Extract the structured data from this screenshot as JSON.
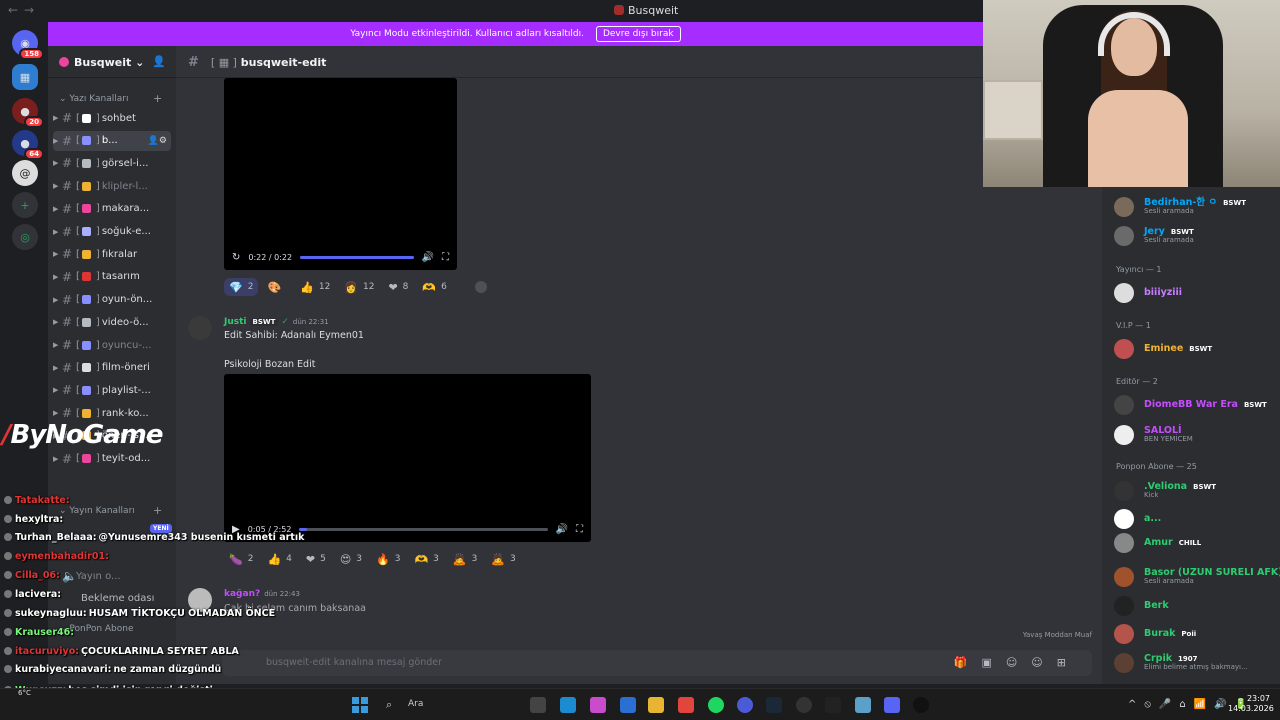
{
  "window": {
    "title": "Busqweit"
  },
  "banner": {
    "text": "Yayıncı Modu etkinleştirildi. Kullanıcı adları kısaltıldı.",
    "button": "Devre dışı bırak"
  },
  "rail": {
    "badges": [
      "158",
      "20",
      "64"
    ]
  },
  "guild": {
    "name": "Busqweit"
  },
  "sidebar": {
    "categories": [
      "Yazı Kanalları",
      "Yayın Kanalları",
      "PonPon Abone"
    ],
    "channels": [
      {
        "name": "sohbet",
        "color": "#dbdee1"
      },
      {
        "name": "b...",
        "color": "#ffffff"
      },
      {
        "name": "görsel-i...",
        "color": "#dbdee1"
      },
      {
        "name": "klipler-l...",
        "color": "#80848e"
      },
      {
        "name": "makara...",
        "color": "#dbdee1"
      },
      {
        "name": "soğuk-e...",
        "color": "#dbdee1"
      },
      {
        "name": "fıkralar",
        "color": "#dbdee1"
      },
      {
        "name": "tasarım",
        "color": "#dbdee1"
      },
      {
        "name": "oyun-ön...",
        "color": "#dbdee1"
      },
      {
        "name": "video-ö...",
        "color": "#dbdee1"
      },
      {
        "name": "oyuncu-...",
        "color": "#80848e"
      },
      {
        "name": "film-öneri",
        "color": "#dbdee1"
      },
      {
        "name": "playlist-...",
        "color": "#dbdee1"
      },
      {
        "name": "rank-ko...",
        "color": "#dbdee1"
      },
      {
        "name": "öneri-is...",
        "color": "#dbdee1"
      },
      {
        "name": "teyit-od...",
        "color": "#dbdee1"
      }
    ],
    "new_badge": "YENİ",
    "voice": {
      "name": "Yayın o...",
      "waiting": "Bekleme odası"
    }
  },
  "channel": {
    "name": "busqweit-edit"
  },
  "messages": [
    {
      "video": {
        "time": "0:22 / 0:22",
        "progress": 1.0
      },
      "reactions": [
        {
          "emoji": "💎",
          "count": "2"
        },
        {
          "emoji": "🎨",
          "count": ""
        },
        {
          "emoji": "👍",
          "count": "12"
        },
        {
          "emoji": "👩",
          "count": "12"
        },
        {
          "emoji": "❤",
          "count": "8"
        },
        {
          "emoji": "🫶",
          "count": "6"
        }
      ]
    },
    {
      "author": "Justi",
      "tag": "BSWT",
      "timestamp": "dün 22:31",
      "lines": [
        "Edit Sahibi: Adanalı Eymen01",
        "Psikoloji Bozan Edit"
      ],
      "video": {
        "time": "0:05 / 2:52",
        "progress": 0.03
      },
      "reactions": [
        {
          "emoji": "🍆",
          "count": "2"
        },
        {
          "emoji": "👍",
          "count": "4"
        },
        {
          "emoji": "❤",
          "count": "5"
        },
        {
          "emoji": "😍",
          "count": "3"
        },
        {
          "emoji": "🔥",
          "count": "3"
        },
        {
          "emoji": "🫶",
          "count": "3"
        },
        {
          "emoji": "🙇",
          "count": "3"
        },
        {
          "emoji": "🙇",
          "count": "3"
        }
      ]
    },
    {
      "author": "kağan?",
      "timestamp": "dün 22:43",
      "lines": [
        "Çak bi selam canım baksanaa"
      ]
    }
  ],
  "composer": {
    "placeholder": "busqweit-edit kanalına mesaj gönder"
  },
  "slowmode": "Yavaş Moddan Muaf",
  "members": {
    "sections": [
      "Yayıncı — 1",
      "V.I.P — 1",
      "Editör — 2",
      "Ponpon Abone — 25"
    ],
    "list": [
      {
        "name": "Bedirhan-한 ㅇ",
        "sub": "Sesli aramada",
        "color": "#00a8fc",
        "tag": "BSWT"
      },
      {
        "name": "Jery",
        "sub": "Sesli aramada",
        "color": "#00a8fc",
        "tag": "BSWT"
      },
      {
        "name": "biiiyziii",
        "sub": "",
        "color": "#c77dff",
        "tag": ""
      },
      {
        "name": "Eminee",
        "sub": "",
        "color": "#f0b232",
        "tag": "BSWT"
      },
      {
        "name": "DiomeBB War Era",
        "sub": "",
        "color": "#c54cff",
        "tag": "BSWT"
      },
      {
        "name": "SALOLİ",
        "sub": "BEN YEMİCEM",
        "color": "#c54cff",
        "tag": ""
      },
      {
        "name": ".Veliona",
        "sub": "Kick",
        "color": "#2ecc71",
        "tag": "BSWT"
      },
      {
        "name": "a...",
        "sub": "",
        "color": "#2ecc71",
        "tag": ""
      },
      {
        "name": "Amur",
        "sub": "",
        "color": "#2ecc71",
        "tag": "CHILL"
      },
      {
        "name": "Basor (UZUN SURELI AFK)",
        "sub": "Sesli aramada",
        "color": "#2ecc71",
        "tag": ""
      },
      {
        "name": "Berk",
        "sub": "",
        "color": "#2ecc71",
        "tag": ""
      },
      {
        "name": "Burak",
        "sub": "",
        "color": "#2ecc71",
        "tag": "Poii"
      },
      {
        "name": "Crpik",
        "sub": "Elimi belime atmış bakmayı...",
        "color": "#2ecc71",
        "tag": "1907"
      }
    ]
  },
  "overlay": {
    "logo": "ByNoGame",
    "chat": [
      {
        "user": "Tatakatte:",
        "text": "",
        "color": "#e13535"
      },
      {
        "user": "hexyltra:",
        "text": "",
        "color": "#ffffff"
      },
      {
        "user": "Turhan_Belaaa:",
        "text": "@Yunusemre343 busenin kısmeti artık",
        "color": "#ffffff"
      },
      {
        "user": "eymenbahadir01:",
        "text": "",
        "color": "#e13535"
      },
      {
        "user": "Cilla_06:",
        "text": "",
        "color": "#e13535"
      },
      {
        "user": "lacivera:",
        "text": "",
        "color": "#ffffff"
      },
      {
        "user": "sukeynagluu:",
        "text": "HUSAM TİKTOKÇU OLMADAN ÖNCE",
        "color": "#ffffff"
      },
      {
        "user": "Krauser46:",
        "text": "",
        "color": "#7cf27c"
      },
      {
        "user": "itacuruviyo:",
        "text": "ÇOCUKLARINLA SEYRET ABLA",
        "color": "#e13535"
      },
      {
        "user": "kurabiyecanavari:",
        "text": "ne zaman düzgündü",
        "color": "#ffffff"
      },
      {
        "user": "Wunsuzz:",
        "text": "hes simdi işin rengi değişti",
        "color": "#7cf27c"
      },
      {
        "user": "eymenbahadir01:",
        "text": "adana merkezz",
        "color": "#e13535"
      }
    ]
  },
  "taskbar": {
    "search": "Ara",
    "weather": "6°C",
    "time": "23:07",
    "date": "14.03.2026"
  }
}
